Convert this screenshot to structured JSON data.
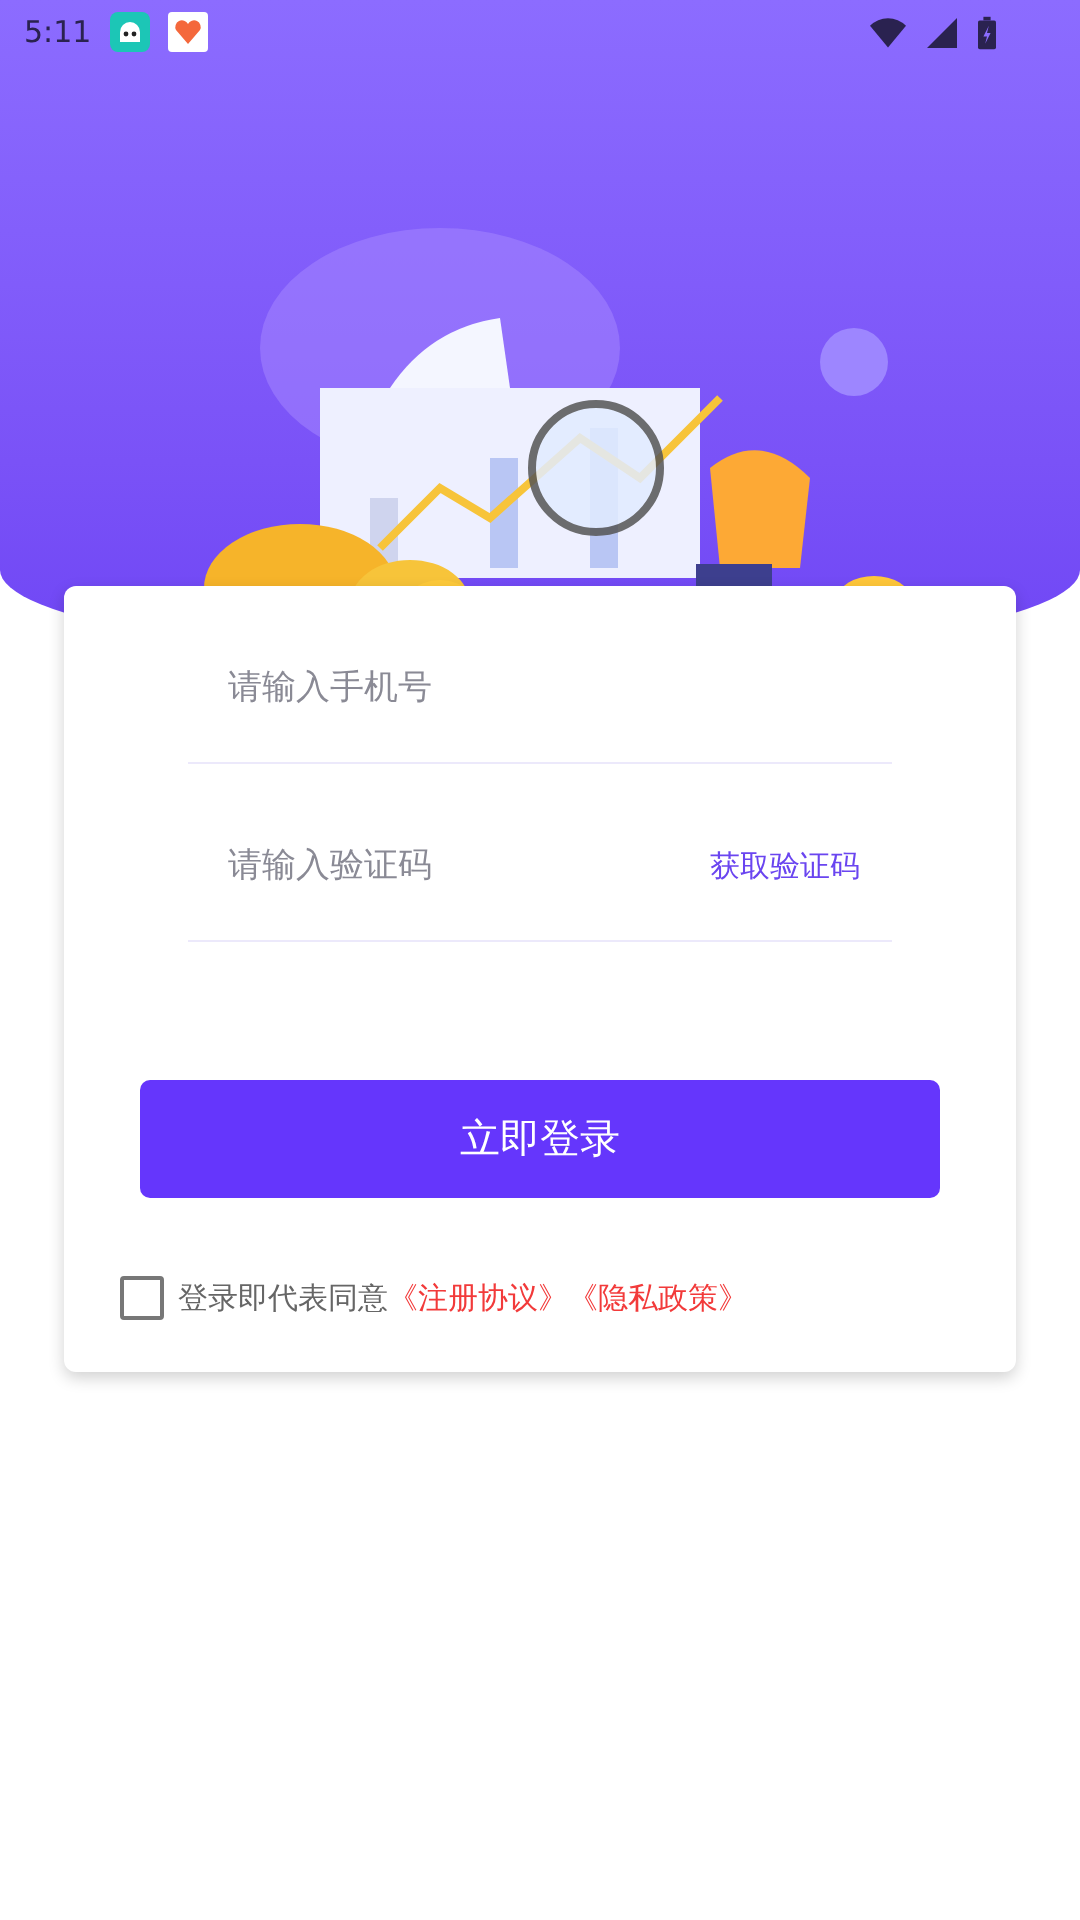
{
  "status_bar": {
    "time": "5:11"
  },
  "form": {
    "phone": {
      "placeholder": "请输入手机号"
    },
    "code": {
      "placeholder": "请输入验证码",
      "action": "获取验证码"
    },
    "submit": "立即登录",
    "agreement": {
      "checked": false,
      "text": "登录即代表同意",
      "links": [
        "《注册协议》",
        "《隐私政策》"
      ]
    }
  }
}
